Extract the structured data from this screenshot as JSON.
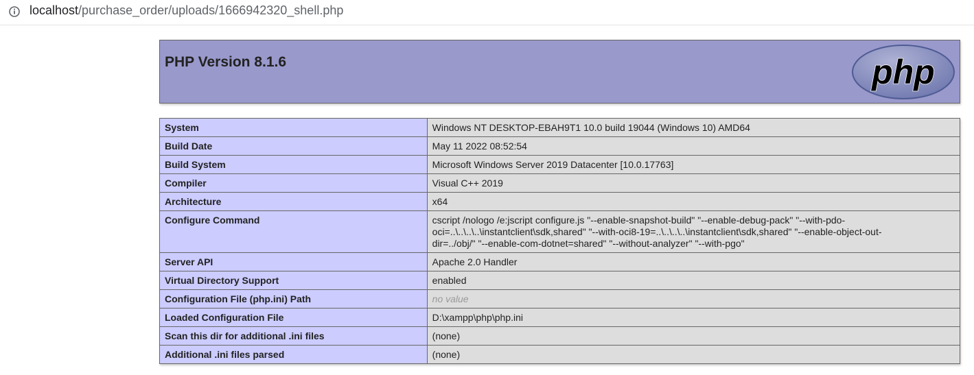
{
  "browser": {
    "url_host": "localhost",
    "url_path": "/purchase_order/uploads/1666942320_shell.php",
    "icon": "info-icon"
  },
  "header": {
    "title": "PHP Version 8.1.6",
    "logo_text": "php",
    "logo_icon": "php-logo"
  },
  "rows": [
    {
      "key": "System",
      "value": "Windows NT DESKTOP-EBAH9T1 10.0 build 19044 (Windows 10) AMD64"
    },
    {
      "key": "Build Date",
      "value": "May 11 2022 08:52:54"
    },
    {
      "key": "Build System",
      "value": "Microsoft Windows Server 2019 Datacenter [10.0.17763]"
    },
    {
      "key": "Compiler",
      "value": "Visual C++ 2019"
    },
    {
      "key": "Architecture",
      "value": "x64"
    },
    {
      "key": "Configure Command",
      "value_lines": [
        "cscript /nologo /e:jscript configure.js \"--enable-snapshot-build\" \"--enable-debug-pack\" \"--with-pdo-",
        "oci=..\\..\\..\\..\\instantclient\\sdk,shared\" \"--with-oci8-19=..\\..\\..\\..\\instantclient\\sdk,shared\" \"--enable-object-out-",
        "dir=../obj/\" \"--enable-com-dotnet=shared\" \"--without-analyzer\" \"--with-pgo\""
      ]
    },
    {
      "key": "Server API",
      "value": "Apache 2.0 Handler"
    },
    {
      "key": "Virtual Directory Support",
      "value": "enabled"
    },
    {
      "key": "Configuration File (php.ini) Path",
      "value": "no value",
      "novalue": true
    },
    {
      "key": "Loaded Configuration File",
      "value": "D:\\xampp\\php\\php.ini"
    },
    {
      "key": "Scan this dir for additional .ini files",
      "value": "(none)"
    },
    {
      "key": "Additional .ini files parsed",
      "value": "(none)"
    }
  ],
  "colors": {
    "header_bg": "#9999cc",
    "key_bg": "#ccccff",
    "value_bg": "#dddddd",
    "no_value_text": "#999999"
  }
}
